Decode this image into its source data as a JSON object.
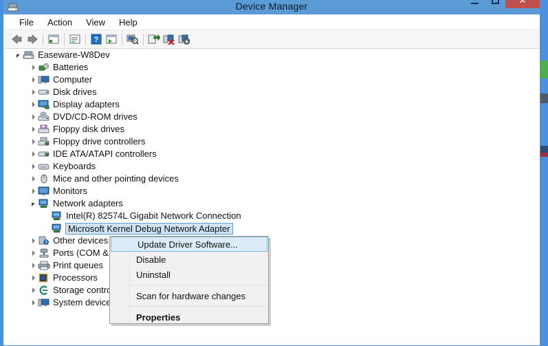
{
  "window": {
    "title": "Device Manager",
    "icon": "device-manager-icon",
    "controls": {
      "minimize": "–",
      "maximize": "□",
      "close": "✕"
    }
  },
  "menubar": {
    "items": [
      {
        "label": "File",
        "name": "menu-file"
      },
      {
        "label": "Action",
        "name": "menu-action"
      },
      {
        "label": "View",
        "name": "menu-view"
      },
      {
        "label": "Help",
        "name": "menu-help"
      }
    ]
  },
  "toolbar": {
    "buttons": [
      {
        "name": "back-icon",
        "glyph": "←"
      },
      {
        "name": "forward-icon",
        "glyph": "→"
      },
      {
        "name": "show-hide-console-tree-icon",
        "glyph": "▤"
      },
      {
        "name": "properties-icon",
        "glyph": "▤"
      },
      {
        "name": "help-icon",
        "glyph": "?"
      },
      {
        "name": "update-driver-icon",
        "glyph": "▤"
      },
      {
        "name": "scan-hardware-changes-icon",
        "glyph": "⌕"
      },
      {
        "name": "enable-device-icon",
        "glyph": "↱"
      },
      {
        "name": "uninstall-device-icon",
        "glyph": "✖"
      },
      {
        "name": "update-driver-software-icon",
        "glyph": "↓"
      }
    ]
  },
  "tree": {
    "root": {
      "label": "Easeware-W8Dev",
      "icon": "computer-root-icon",
      "expanded": true
    },
    "nodes": [
      {
        "label": "Batteries",
        "icon": "battery-icon",
        "expanded": false,
        "selected": false
      },
      {
        "label": "Computer",
        "icon": "computer-icon",
        "expanded": false,
        "selected": false
      },
      {
        "label": "Disk drives",
        "icon": "disk-drive-icon",
        "expanded": false,
        "selected": false
      },
      {
        "label": "Display adapters",
        "icon": "display-adapter-icon",
        "expanded": false,
        "selected": false
      },
      {
        "label": "DVD/CD-ROM drives",
        "icon": "dvd-drive-icon",
        "expanded": false,
        "selected": false
      },
      {
        "label": "Floppy disk drives",
        "icon": "floppy-disk-icon",
        "expanded": false,
        "selected": false
      },
      {
        "label": "Floppy drive controllers",
        "icon": "floppy-controller-icon",
        "expanded": false,
        "selected": false
      },
      {
        "label": "IDE ATA/ATAPI controllers",
        "icon": "ide-controller-icon",
        "expanded": false,
        "selected": false
      },
      {
        "label": "Keyboards",
        "icon": "keyboard-icon",
        "expanded": false,
        "selected": false
      },
      {
        "label": "Mice and other pointing devices",
        "icon": "mouse-icon",
        "expanded": false,
        "selected": false
      },
      {
        "label": "Monitors",
        "icon": "monitor-icon",
        "expanded": false,
        "selected": false
      },
      {
        "label": "Network adapters",
        "icon": "network-adapter-icon",
        "expanded": true,
        "selected": false
      },
      {
        "label": "Other devices",
        "icon": "other-devices-icon",
        "expanded": false,
        "selected": false
      },
      {
        "label": "Ports (COM & L",
        "icon": "ports-icon",
        "expanded": false,
        "selected": false
      },
      {
        "label": "Print queues",
        "icon": "print-queue-icon",
        "expanded": false,
        "selected": false
      },
      {
        "label": "Processors",
        "icon": "processor-icon",
        "expanded": false,
        "selected": false
      },
      {
        "label": "Storage control",
        "icon": "storage-controller-icon",
        "expanded": false,
        "selected": false
      },
      {
        "label": "System devices",
        "icon": "system-device-icon",
        "expanded": false,
        "selected": false
      }
    ],
    "network_children": [
      {
        "label": "Intel(R) 82574L Gigabit Network Connection",
        "icon": "network-adapter-icon",
        "selected": false
      },
      {
        "label": "Microsoft Kernel Debug Network Adapter",
        "icon": "network-adapter-icon",
        "selected": true
      }
    ]
  },
  "context_menu": {
    "items": [
      {
        "label": "Update Driver Software...",
        "name": "ctx-update-driver-software",
        "highlighted": true,
        "bold": false
      },
      {
        "label": "Disable",
        "name": "ctx-disable",
        "highlighted": false,
        "bold": false
      },
      {
        "label": "Uninstall",
        "name": "ctx-uninstall",
        "highlighted": false,
        "bold": false
      },
      {
        "label": "Scan for hardware changes",
        "name": "ctx-scan-hardware-changes",
        "highlighted": false,
        "bold": false
      },
      {
        "label": "Properties",
        "name": "ctx-properties",
        "highlighted": false,
        "bold": true
      }
    ]
  },
  "colors": {
    "titlebar": "#5b9bd5",
    "close_button": "#c0504d",
    "selection_fill": "#cfe3f5",
    "selection_border": "#5a9fd8",
    "menu_background": "#f1f1f1",
    "menu_highlight": "#dcebf8"
  }
}
